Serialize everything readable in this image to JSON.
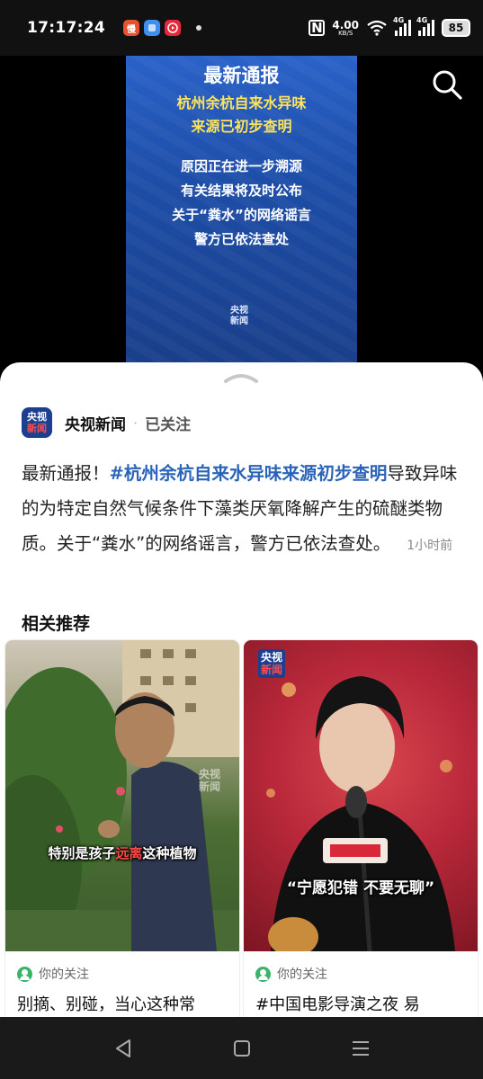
{
  "status_bar": {
    "time": "17:17:24",
    "apps": [
      {
        "icon": "app-icon-orange",
        "glyph": "慢",
        "color": "#e8502e"
      },
      {
        "icon": "app-icon-blue",
        "glyph": "",
        "color": "#3f8ff0"
      },
      {
        "icon": "app-icon-red",
        "glyph": "",
        "color": "#e8283a"
      }
    ],
    "nfc": "N",
    "net_speed": "4.00",
    "net_unit": "KB/S",
    "network_1": "4G",
    "network_2": "4G",
    "battery": "85"
  },
  "video": {
    "title": "最新通报",
    "subtitle_lines": [
      "杭州余杭自来水异味",
      "来源已初步查明"
    ],
    "body_lines": [
      "原因正在进一步溯源",
      "有关结果将及时公布",
      "关于“粪水”的网络谣言",
      "警方已依法查处"
    ],
    "logo": [
      "央视",
      "新闻"
    ]
  },
  "post": {
    "avatar": [
      "央视",
      "新闻"
    ],
    "author": "央视新闻",
    "separator": "·",
    "follow_state": "已关注",
    "text_prefix": "最新通报！",
    "hashtag": "#杭州余杭自来水异味来源初步查明",
    "text_body": "导致异味的为特定自然气候条件下藻类厌氧降解产生的硫醚类物质。关于“粪水”的网络谣言，警方已依法查处。",
    "time": "1小时前"
  },
  "related": {
    "title": "相关推荐",
    "cards": [
      {
        "caption_before": "特别是孩子",
        "caption_highlight": "远离",
        "caption_after": "这种植物",
        "watermark": [
          "央视",
          "新闻"
        ],
        "meta": "你的关注",
        "title": "别摘、别碰，当心这种常"
      },
      {
        "caption": "“宁愿犯错 不要无聊”",
        "watermark": [
          "央视",
          "新闻"
        ],
        "meta": "你的关注",
        "title": "#中国电影导演之夜 易"
      }
    ]
  }
}
